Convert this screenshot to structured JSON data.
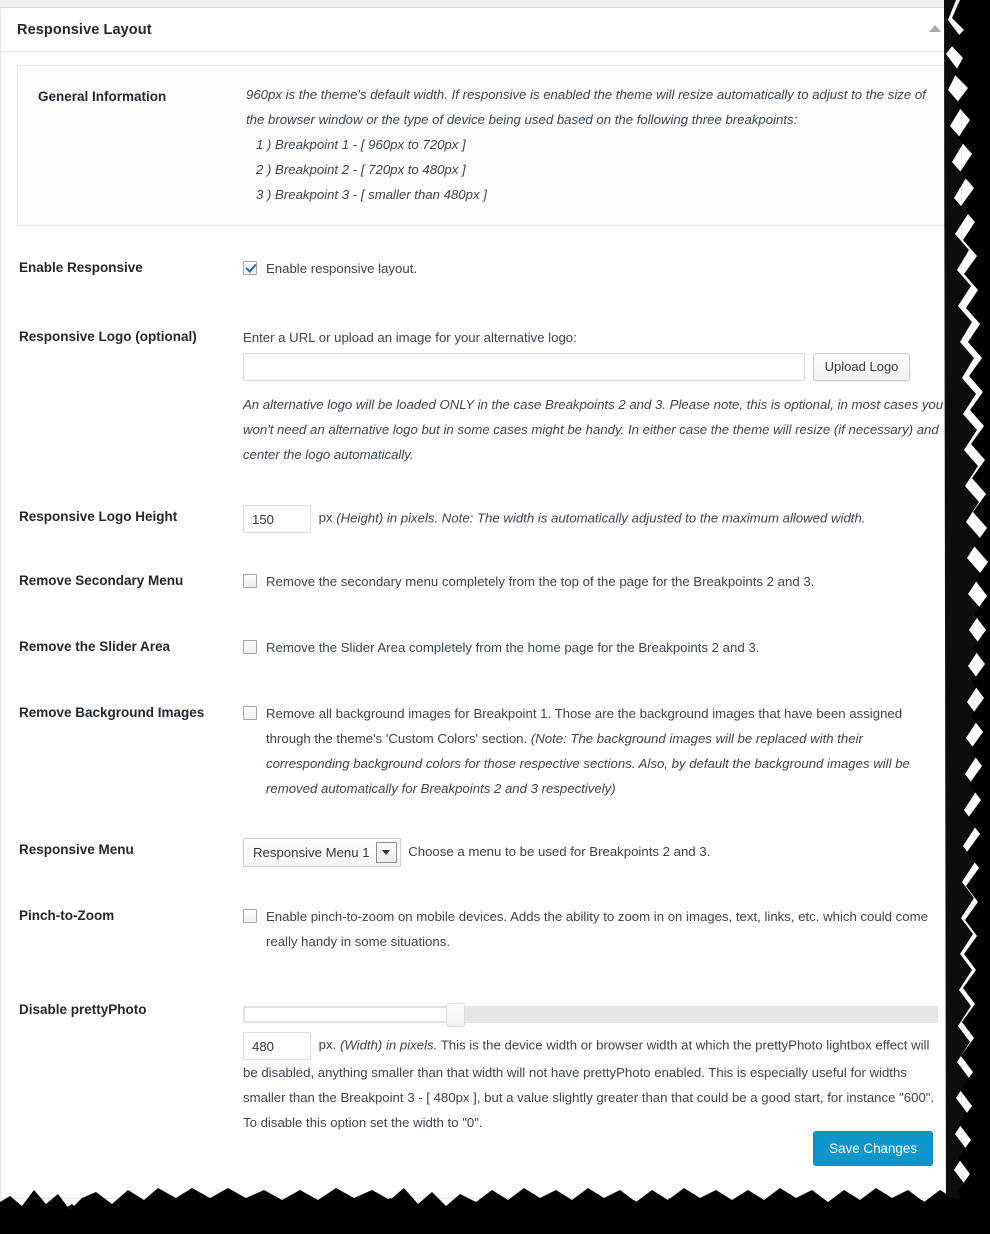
{
  "panel": {
    "title": "Responsive Layout",
    "collapse_icon": "triangle-up-icon"
  },
  "general_information": {
    "label": "General Information",
    "paragraph": "960px is the theme's default width. If responsive is enabled the theme will resize automatically to adjust to the size of the browser window or the type of device being used based on the following three breakpoints:",
    "breakpoints": [
      "1 ) Breakpoint 1 - [ 960px to 720px ]",
      "2 ) Breakpoint 2 - [ 720px to 480px ]",
      "3 ) Breakpoint 3 - [ smaller than 480px ]"
    ]
  },
  "rows": {
    "enable_responsive": {
      "label": "Enable Responsive",
      "checkbox_label": "Enable responsive layout.",
      "checked": true
    },
    "responsive_logo": {
      "label": "Responsive Logo (optional)",
      "intro": "Enter a URL or upload an image for your alternative logo:",
      "input_value": "",
      "input_placeholder": "",
      "upload_button": "Upload Logo",
      "note": "An alternative logo will be loaded ONLY in the case Breakpoints 2 and 3. Please note, this is optional, in most cases you won't need an alternative logo but in some cases might be handy. In either case the theme will resize (if necessary) and center the logo automatically."
    },
    "responsive_logo_height": {
      "label": "Responsive Logo Height",
      "input_value": "150",
      "suffix_plain": "px ",
      "suffix_italic": "(Height) in pixels. Note: The width is automatically adjusted to the maximum allowed width."
    },
    "remove_secondary_menu": {
      "label": "Remove Secondary Menu",
      "checkbox_label": "Remove the secondary menu completely from the top of the page for the Breakpoints 2 and 3.",
      "checked": false
    },
    "remove_slider_area": {
      "label": "Remove the Slider Area",
      "checkbox_label": "Remove the Slider Area completely from the home page for the Breakpoints 2 and 3.",
      "checked": false
    },
    "remove_background_images": {
      "label": "Remove Background Images",
      "checkbox_label": "Remove all background images for Breakpoint 1. Those are the background images that have been assigned through the theme's 'Custom Colors' section. ",
      "checkbox_note_italic": "(Note: The background images will be replaced with their corresponding background colors for those respective sections. Also, by default the background images will be removed automatically for Breakpoints 2 and 3 respectively)",
      "checked": false
    },
    "responsive_menu": {
      "label": "Responsive Menu",
      "selected_option": "Responsive Menu 1",
      "options": [
        "Responsive Menu 1"
      ],
      "description": "Choose a menu to be used for Breakpoints 2 and 3."
    },
    "pinch_to_zoom": {
      "label": "Pinch-to-Zoom",
      "checkbox_label": "Enable pinch-to-zoom on mobile devices. Adds the ability to zoom in on images, text, links, etc. which could come really handy in some situations.",
      "checked": false
    },
    "disable_prettyphoto": {
      "label": "Disable prettyPhoto",
      "slider_value": 480,
      "slider_min": 0,
      "slider_max": 1600,
      "input_value": "480",
      "suffix_plain": "px. ",
      "suffix_italic": "(Width) in pixels.",
      "description": " This is the device width or browser width at which the prettyPhoto lightbox effect will be disabled, anything smaller than that width will not have prettyPhoto enabled. This is especially useful for widths smaller than the Breakpoint 3 - [ 480px ], but a value slightly greater than that could be a good start, for instance \"600\". To disable this option set the width to \"0\"."
    }
  },
  "footer": {
    "save_label": "Save Changes",
    "save_color": "#0e96cb"
  }
}
